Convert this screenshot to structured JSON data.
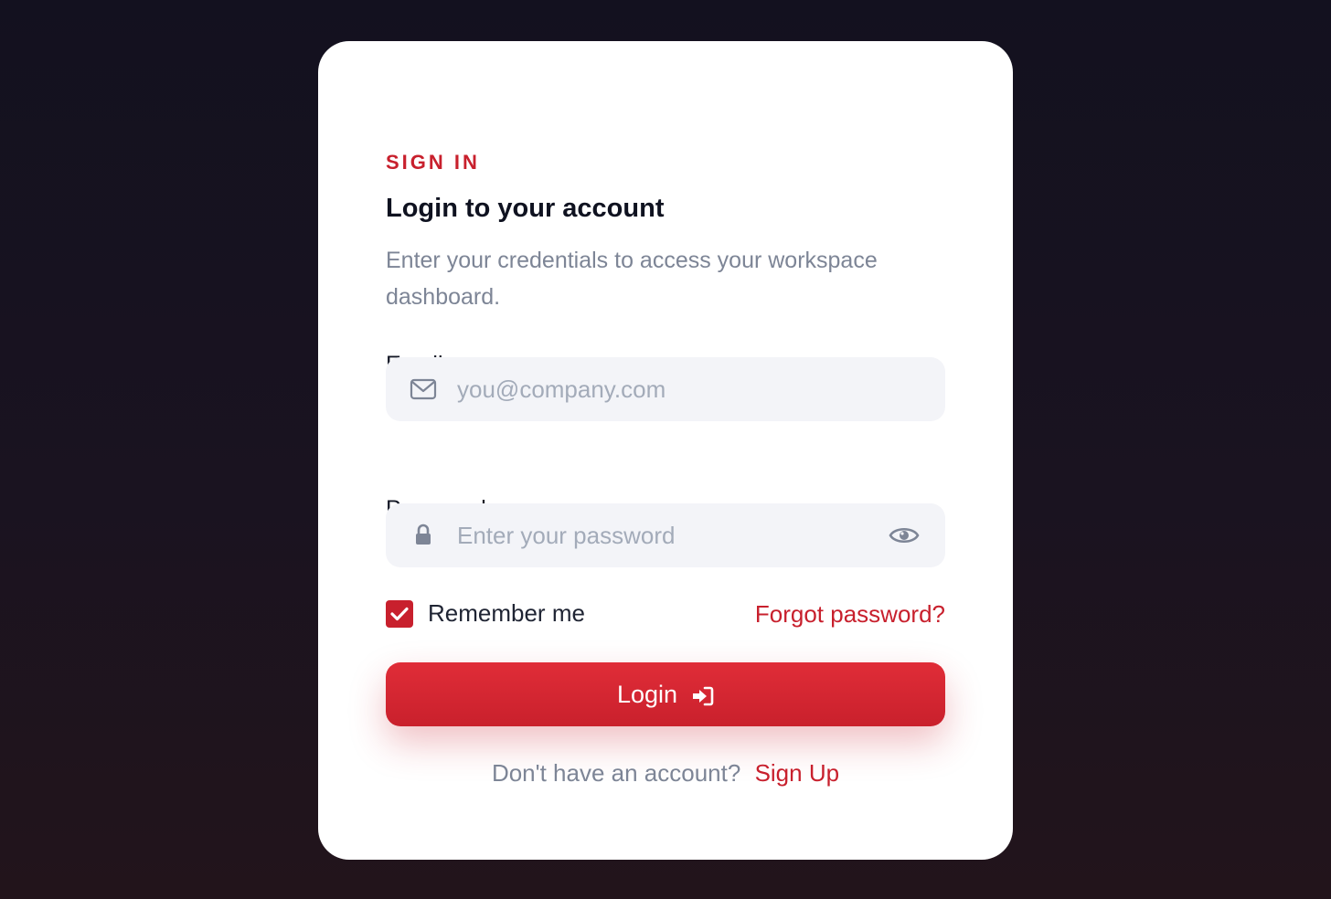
{
  "card": {
    "eyebrow": "SIGN IN",
    "title": "Login to your account",
    "subtitle": "Enter your credentials to access your workspace dashboard."
  },
  "email": {
    "label": "Email",
    "placeholder": "you@company.com",
    "value": "",
    "icon": "mail-icon"
  },
  "password": {
    "label": "Password",
    "placeholder": "Enter your password",
    "value": "",
    "icon": "lock-icon",
    "toggle_icon": "eye-icon"
  },
  "remember": {
    "label": "Remember me",
    "checked": true
  },
  "forgot": {
    "label": "Forgot password?"
  },
  "login_button": {
    "label": "Login",
    "icon": "sign-in-icon"
  },
  "signup": {
    "prompt": "Don't have an account?",
    "link": "Sign Up"
  },
  "colors": {
    "accent": "#c8202d",
    "field_bg": "#f3f4f8",
    "muted_text": "#7d8596",
    "background": "#15121f"
  }
}
